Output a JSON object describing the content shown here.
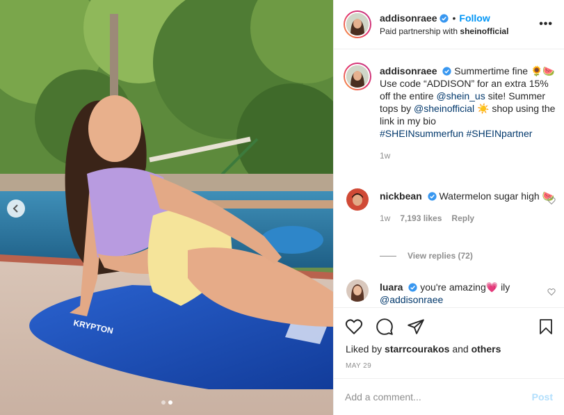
{
  "post": {
    "photo_alt": "Woman posing by a pool on a blue Krypton bodyboard",
    "board_brand": "KRYPTON",
    "carousel": {
      "prev_icon": "chevron-left-icon",
      "dots": 2,
      "active_dot": 2
    }
  },
  "header": {
    "username": "addisonraee",
    "separator": "•",
    "follow_label": "Follow",
    "partnership_prefix": "Paid partnership with ",
    "partner": "sheinofficial",
    "more_icon": "ellipsis-icon",
    "more_label": "•••"
  },
  "caption": {
    "username": "addisonraee",
    "line1": "Summertime fine 🌻🍉",
    "line2": "Use code “ADDISON”  for an extra 15% off the entire ",
    "mention1": "@shein_us",
    "line3": " site! Summer tops by ",
    "mention2": "@sheinofficial",
    "line4": " ☀️  shop using the link in my bio",
    "hashtag1": "#SHEINsummerfun",
    "hashtag2": "#SHEINpartner",
    "time": "1w"
  },
  "comments": [
    {
      "username": "nickbean",
      "text": "Watermelon sugar high 🍉",
      "time": "1w",
      "likes": "7,193 likes",
      "reply_label": "Reply",
      "view_replies": "View replies (72)"
    },
    {
      "username": "luara",
      "text": "you're amazing💗 ily ",
      "mention": "@addisonraee"
    }
  ],
  "actions": {
    "like_icon": "heart-icon",
    "comment_icon": "comment-icon",
    "share_icon": "share-icon",
    "save_icon": "bookmark-icon",
    "liked_by_prefix": "Liked by ",
    "liked_by_user": "starrcourakos",
    "liked_by_and": " and ",
    "liked_by_others": "others",
    "date": "MAY 29"
  },
  "composer": {
    "placeholder": "Add a comment...",
    "post_label": "Post"
  },
  "colors": {
    "accent": "#0095f6",
    "link": "#00376b",
    "muted": "#8e8e8e",
    "post_disabled": "#b2dffc",
    "board": "#1d4fb8"
  }
}
